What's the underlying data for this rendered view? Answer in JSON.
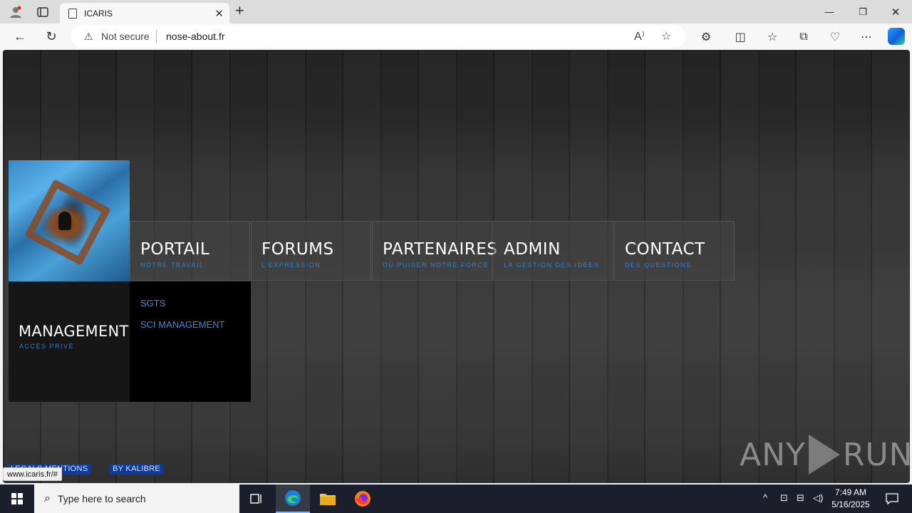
{
  "browser": {
    "tab_title": "ICARIS",
    "new_tab": "+",
    "security_label": "Not secure",
    "url": "nose-about.fr",
    "window_controls": {
      "minimize": "—",
      "restore": "❐",
      "close": "✕"
    },
    "status_url": "www.icaris.fr/#"
  },
  "site": {
    "nav": [
      {
        "label": "PORTAIL",
        "sub": "NOTRE TRAVAIL"
      },
      {
        "label": "FORUMS",
        "sub": "L'EXPRESSION"
      },
      {
        "label": "PARTENAIRES",
        "sub": "OÙ PUISER NOTRE FORCE"
      },
      {
        "label": "ADMIN",
        "sub": "LA GESTION DES IDÉES"
      },
      {
        "label": "CONTACT",
        "sub": "DES QUESTIONS"
      }
    ],
    "management": {
      "label": "MANAGEMENT",
      "sub": "ACCÈS PRIVÉ"
    },
    "submenu": [
      "SGTS",
      "SCI MANAGEMENT"
    ],
    "footer": {
      "legal": "LEGALS MENTIONS",
      "credit": "BY KALIBRE"
    },
    "watermark_left": "ANY",
    "watermark_right": "RUN"
  },
  "taskbar": {
    "search_placeholder": "Type here to search",
    "time": "7:49 AM",
    "date": "5/16/2025"
  }
}
